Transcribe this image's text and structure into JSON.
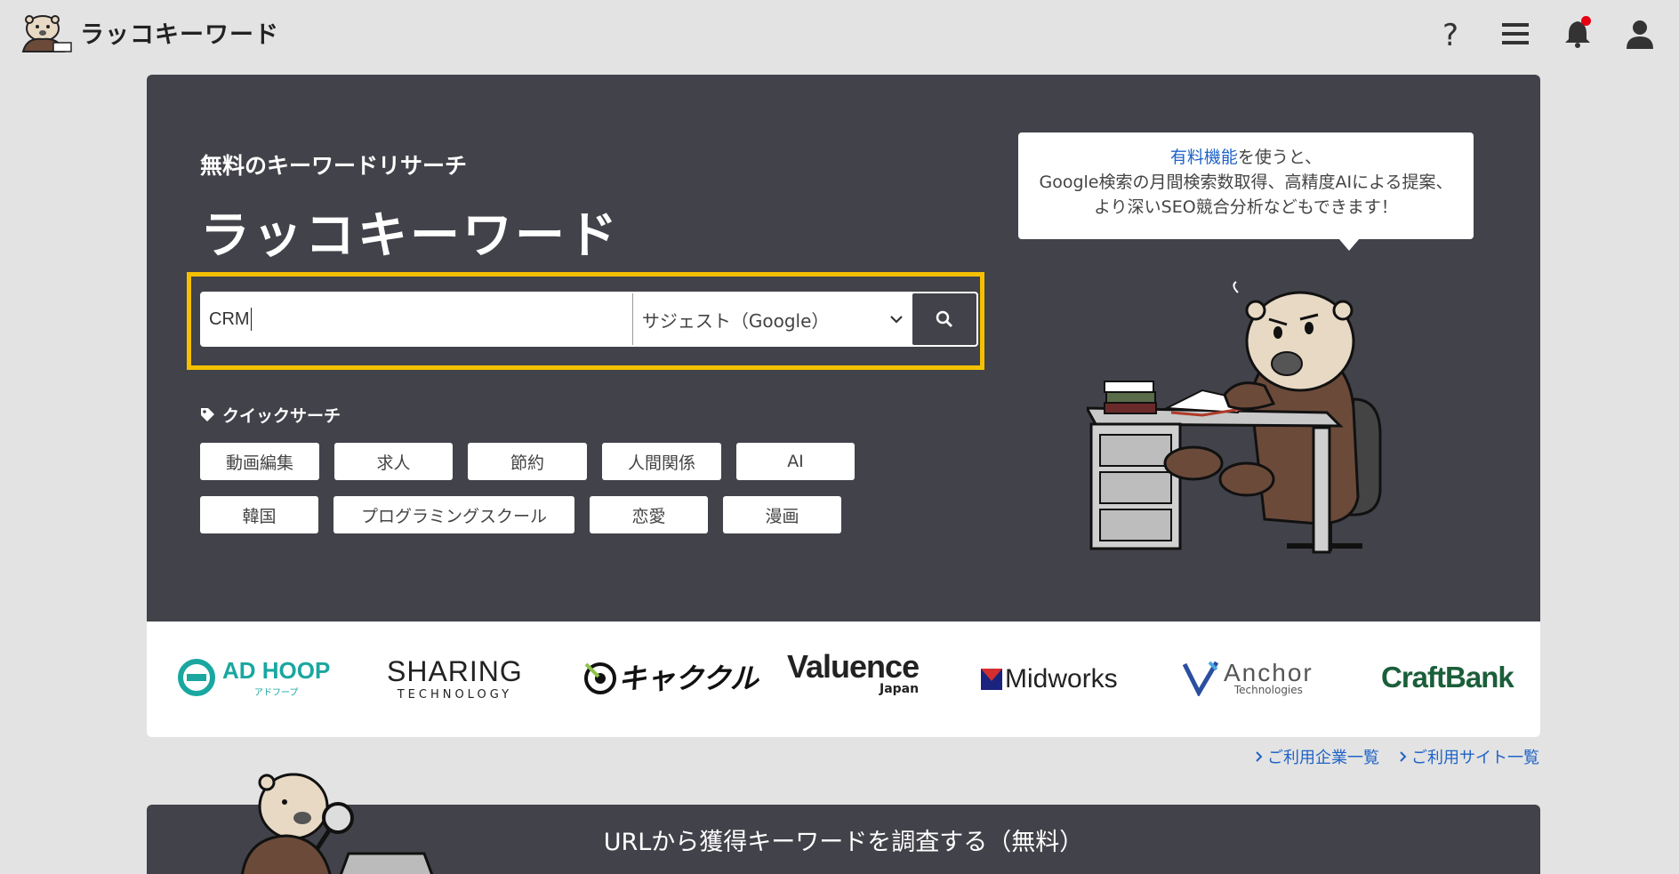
{
  "header": {
    "logo_text": "ラッコキーワード",
    "icons": [
      "help-icon",
      "menu-icon",
      "bell-icon",
      "user-icon"
    ]
  },
  "hero": {
    "subtitle": "無料のキーワードリサーチ",
    "title": "ラッコキーワード",
    "search": {
      "value": "CRM",
      "select_value": "サジェスト（Google）"
    },
    "quick_search_label": "クイックサーチ",
    "quick_row1": [
      "動画編集",
      "求人",
      "節約",
      "人間関係",
      "AI"
    ],
    "quick_row2": [
      "韓国",
      "プログラミングスクール",
      "恋愛",
      "漫画"
    ],
    "bubble": {
      "link": "有料機能",
      "line1_rest": "を使うと、",
      "line2": "Google検索の月間検索数取得、高精度AIによる提案、",
      "line3": "より深いSEO競合分析などもできます！"
    }
  },
  "brands": {
    "adhoop": "AD HOOP",
    "adhoop_sub": "アドフープ",
    "sharing": "SHARING",
    "sharing_sub": "TECHNOLOGY",
    "kyakukuru": "キャククル",
    "valuence": "Valuence",
    "valuence_sub": "Japan",
    "midworks": "Midworks",
    "anchor": "Anchor",
    "anchor_sub": "Technologies",
    "craftbank": "CraftBank"
  },
  "links": {
    "companies": "ご利用企業一覧",
    "sites": "ご利用サイト一覧"
  },
  "url_section": {
    "title": "URLから獲得キーワードを調査する（無料）"
  },
  "colors": {
    "hero_bg": "#42424a",
    "highlight": "#f5c000",
    "link": "#1f63c7",
    "notif": "#e60012"
  }
}
